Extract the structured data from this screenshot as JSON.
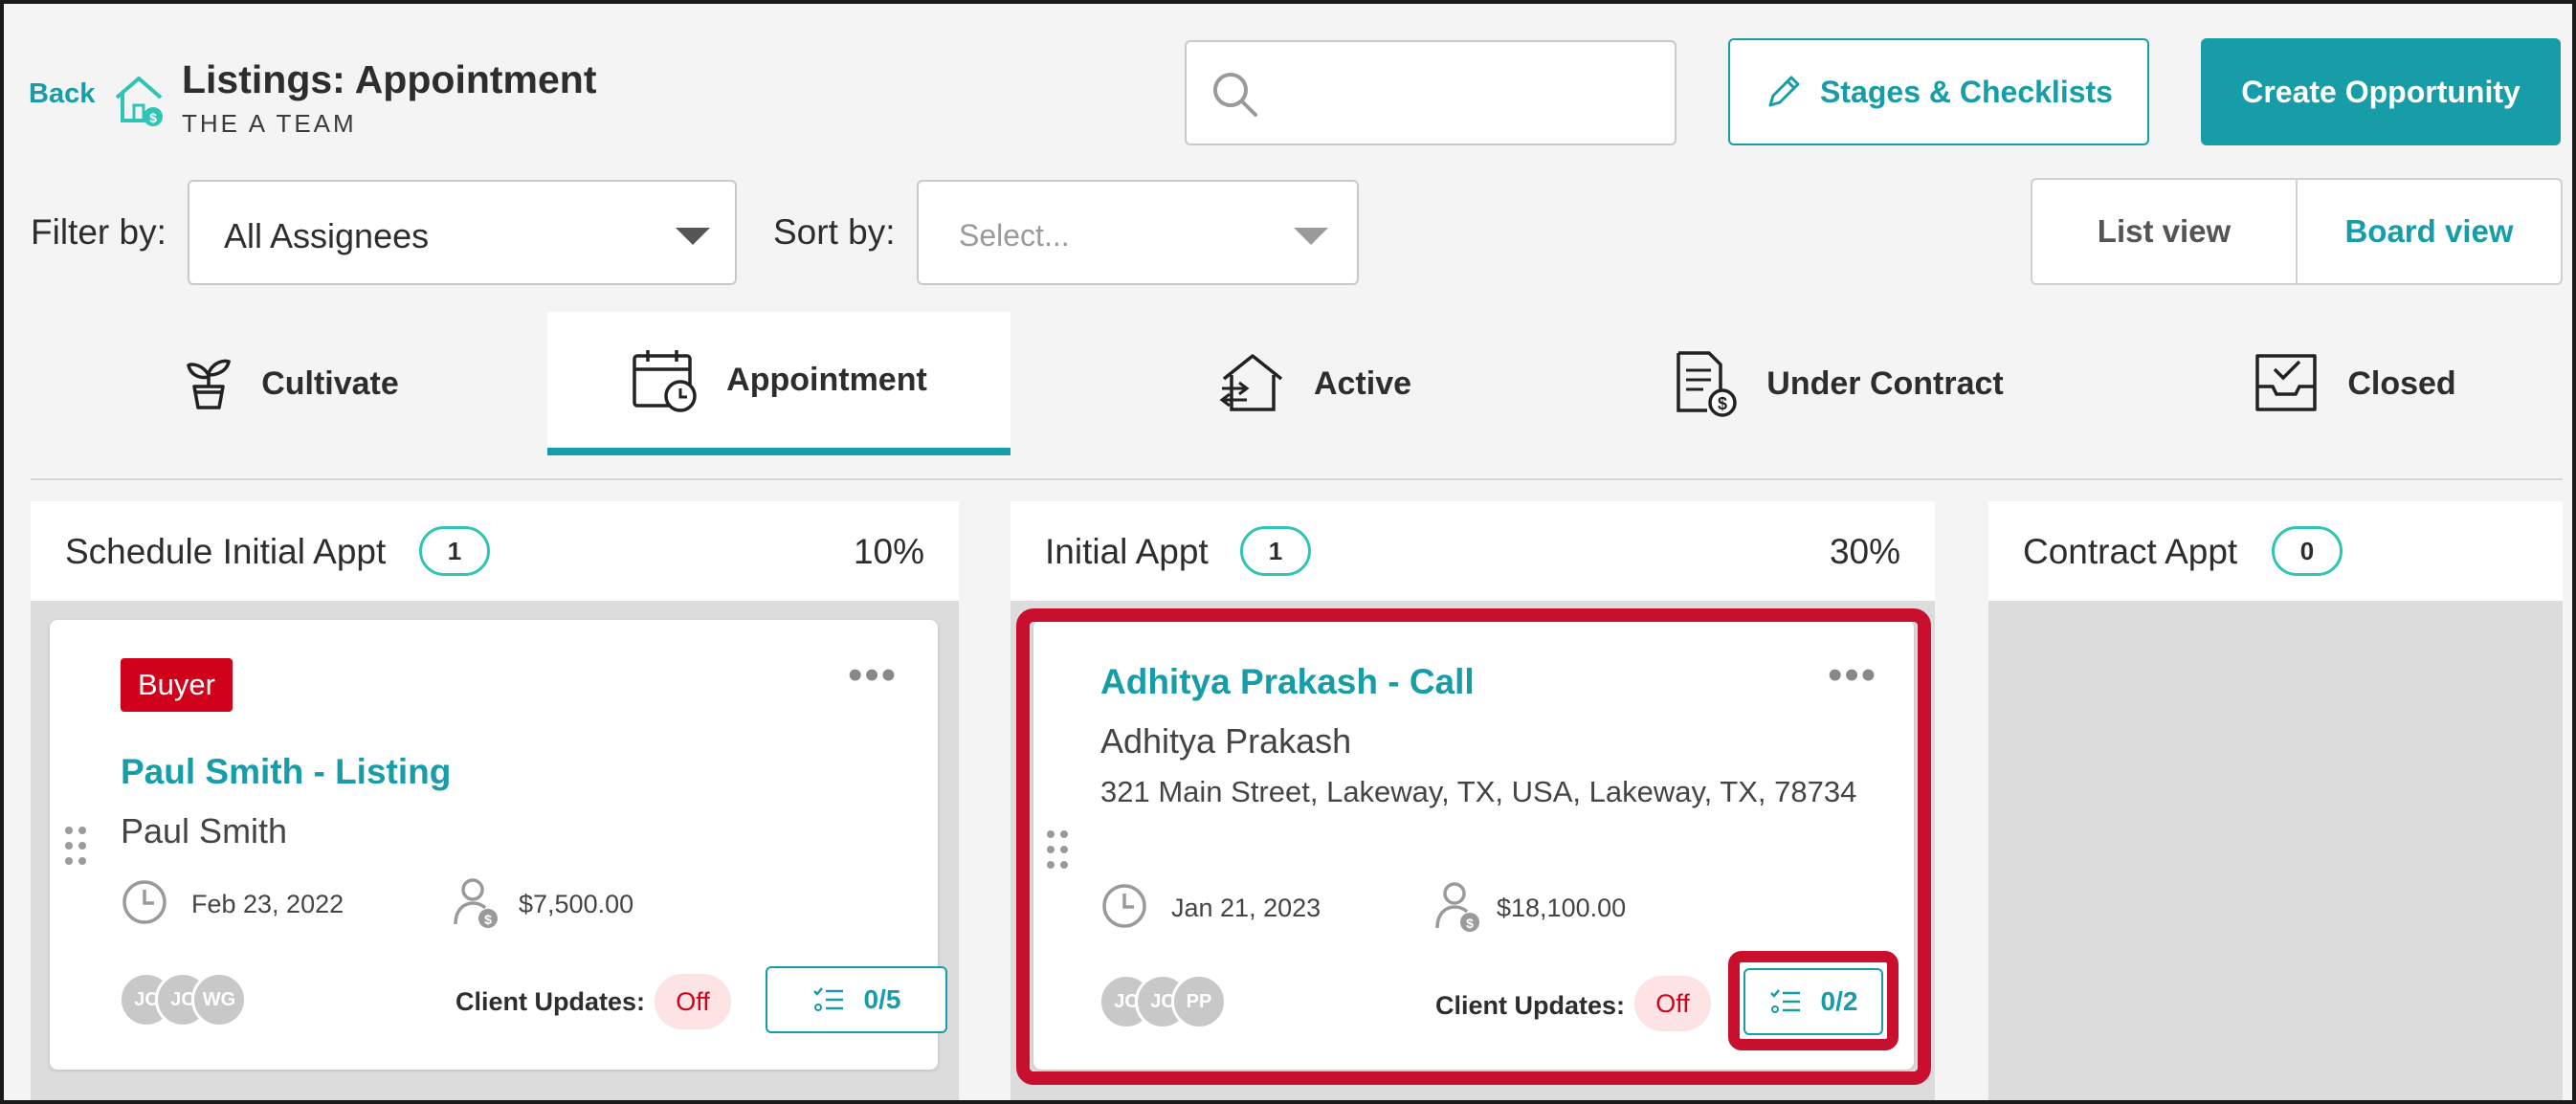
{
  "header": {
    "back_label": "Back",
    "title": "Listings: Appointment",
    "subtitle": "THE A TEAM",
    "search_placeholder": "",
    "stages_button": "Stages & Checklists",
    "create_button": "Create Opportunity"
  },
  "filters": {
    "filter_label": "Filter by:",
    "filter_value": "All Assignees",
    "sort_label": "Sort by:",
    "sort_placeholder": "Select..."
  },
  "view_toggle": {
    "list": "List view",
    "board": "Board view",
    "active": "board"
  },
  "stages": [
    {
      "label": "Cultivate",
      "icon": "sprout-icon"
    },
    {
      "label": "Appointment",
      "icon": "calendar-clock-icon",
      "active": true
    },
    {
      "label": "Active",
      "icon": "house-arrows-icon"
    },
    {
      "label": "Under Contract",
      "icon": "document-dollar-icon"
    },
    {
      "label": "Closed",
      "icon": "inbox-check-icon"
    }
  ],
  "columns": [
    {
      "name": "Schedule Initial Appt",
      "count": "1",
      "percent": "10%",
      "cards": [
        {
          "badge": "Buyer",
          "title": "Paul Smith - Listing",
          "person": "Paul Smith",
          "date": "Feb 23, 2022",
          "amount": "$7,500.00",
          "avatars": [
            "JC",
            "JC",
            "WG"
          ],
          "client_updates_label": "Client Updates:",
          "client_updates_value": "Off",
          "checklist": "0/5"
        }
      ]
    },
    {
      "name": "Initial Appt",
      "count": "1",
      "percent": "30%",
      "cards": [
        {
          "title": "Adhitya Prakash - Call",
          "person": "Adhitya Prakash",
          "address": "321 Main Street, Lakeway, TX, USA, Lakeway, TX, 78734",
          "date": "Jan 21, 2023",
          "amount": "$18,100.00",
          "avatars": [
            "JC",
            "JC",
            "PP"
          ],
          "client_updates_label": "Client Updates:",
          "client_updates_value": "Off",
          "checklist": "0/2"
        }
      ]
    },
    {
      "name": "Contract Appt",
      "count": "0",
      "percent": "",
      "cards": []
    }
  ],
  "colors": {
    "accent": "#169da8",
    "highlight": "#c8102e",
    "badge": "#d0021b"
  }
}
